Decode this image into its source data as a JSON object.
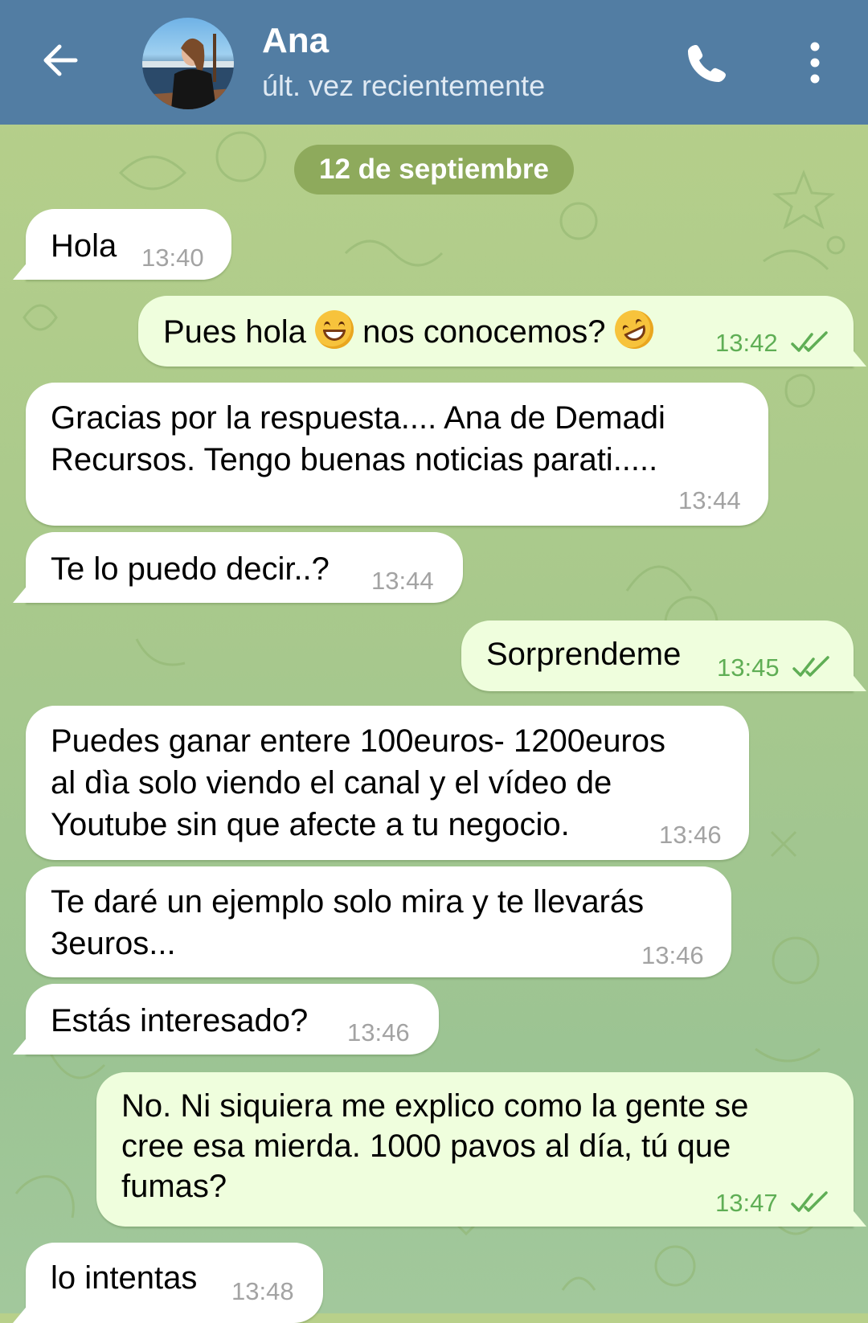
{
  "header": {
    "contact_name": "Ana",
    "status": "últ. vez recientemente",
    "icons": [
      "back-arrow-icon",
      "phone-icon",
      "more-vertical-icon"
    ]
  },
  "date_separator": "12 de septiembre",
  "messages": [
    {
      "dir": "in",
      "lines": [
        "Hola"
      ],
      "time": "13:40"
    },
    {
      "dir": "out",
      "parts": [
        "Pues hola ",
        " nos conocemos? "
      ],
      "emojis": [
        "grinning-face-emoji",
        "rofl-emoji"
      ],
      "time": "13:42",
      "read": true
    },
    {
      "dir": "in",
      "lines": [
        "Gracias por la respuesta.... Ana de   Demadi",
        "Recursos. Tengo buenas noticias parati....."
      ],
      "time": "13:44"
    },
    {
      "dir": "in",
      "lines": [
        "Te lo puedo decir..?"
      ],
      "time": "13:44"
    },
    {
      "dir": "out",
      "lines": [
        "Sorprendeme"
      ],
      "time": "13:45",
      "read": true
    },
    {
      "dir": "in",
      "lines": [
        "Puedes ganar entere 100euros- 1200euros",
        "al dìa solo viendo el canal y el vídeo de",
        "Youtube sin que afecte a tu negocio."
      ],
      "time": "13:46"
    },
    {
      "dir": "in",
      "lines": [
        "Te daré un ejemplo solo mira y te llevarás",
        "3euros..."
      ],
      "time": "13:46"
    },
    {
      "dir": "in",
      "lines": [
        "Estás interesado?"
      ],
      "time": "13:46"
    },
    {
      "dir": "out",
      "lines": [
        "No. Ni siquiera me explico como la gente se",
        "cree esa mierda. 1000 pavos al día, tú que",
        "fumas?"
      ],
      "time": "13:47",
      "read": true
    },
    {
      "dir": "in",
      "lines": [
        "lo intentas"
      ],
      "time": "13:48"
    }
  ],
  "colors": {
    "header": "#527da3",
    "incoming_bubble": "#ffffff",
    "outgoing_bubble": "#effedd",
    "outgoing_time": "#5fae55",
    "date_pill": "#8eaa5c"
  }
}
